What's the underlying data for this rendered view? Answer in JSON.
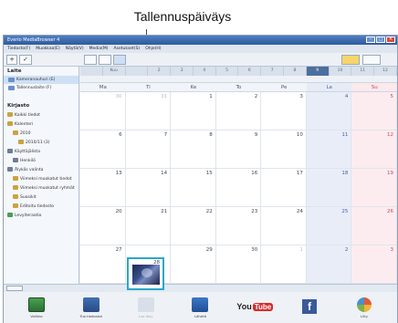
{
  "callout": {
    "label": "Tallennuspäiväys"
  },
  "window": {
    "title": "Everio MediaBrowser 4",
    "menu": [
      "Tiedosto(F)",
      "Muokkaa(E)",
      "Näytä(V)",
      "Media(M)",
      "Asetukset(S)",
      "Ohje(H)"
    ],
    "buttons": {
      "minimize": "–",
      "maximize": "□",
      "close": "×"
    }
  },
  "toolbar": {
    "add": "+",
    "tools": "✓",
    "display": "Grid",
    "zoom": "▢"
  },
  "library": {
    "header": "Laite",
    "items": [
      {
        "label": "Kameranauhuri (E)",
        "selected": true
      },
      {
        "label": "Tallennuslaite (F)",
        "selected": false
      }
    ]
  },
  "tree": {
    "header": "Kirjasto",
    "items": [
      {
        "label": "Kaikki tiedot",
        "indent": 0,
        "icon": "folder"
      },
      {
        "label": "Kalenteri",
        "indent": 0,
        "icon": "folder"
      },
      {
        "label": "2010",
        "indent": 1,
        "icon": "folder"
      },
      {
        "label": "2010/11 (3)",
        "indent": 2,
        "icon": "folder"
      },
      {
        "label": "Käyttäjälista",
        "indent": 0,
        "icon": "people"
      },
      {
        "label": "Henkilö",
        "indent": 1,
        "icon": "people"
      },
      {
        "label": "Älykäs valinta",
        "indent": 0,
        "icon": "people"
      },
      {
        "label": "Viimeksi muokatut tiedot",
        "indent": 1,
        "icon": "folder"
      },
      {
        "label": "Viimeksi muokatut ryhmät",
        "indent": 1,
        "icon": "folder"
      },
      {
        "label": "Suosikit",
        "indent": 1,
        "icon": "folder"
      },
      {
        "label": "Editoitu tiedosto",
        "indent": 1,
        "icon": "folder"
      },
      {
        "label": "Levyiteraatio",
        "indent": 0,
        "icon": "globe"
      }
    ]
  },
  "calendar": {
    "months": [
      "",
      "Kuu",
      "",
      "2",
      "3",
      "4",
      "5",
      "6",
      "7",
      "8",
      "9",
      "10",
      "11",
      "12"
    ],
    "current_month_index": 10,
    "weekdays": [
      "Ma",
      "Ti",
      "Ke",
      "To",
      "Pe",
      "La",
      "Su"
    ],
    "weeks": [
      [
        {
          "d": "30",
          "dim": true
        },
        {
          "d": "31",
          "dim": true
        },
        {
          "d": "1"
        },
        {
          "d": "2"
        },
        {
          "d": "3"
        },
        {
          "d": "4"
        },
        {
          "d": "5"
        }
      ],
      [
        {
          "d": "6"
        },
        {
          "d": "7"
        },
        {
          "d": "8"
        },
        {
          "d": "9"
        },
        {
          "d": "10"
        },
        {
          "d": "11"
        },
        {
          "d": "12"
        }
      ],
      [
        {
          "d": "13"
        },
        {
          "d": "14"
        },
        {
          "d": "15"
        },
        {
          "d": "16"
        },
        {
          "d": "17"
        },
        {
          "d": "18"
        },
        {
          "d": "19"
        }
      ],
      [
        {
          "d": "20"
        },
        {
          "d": "21"
        },
        {
          "d": "22"
        },
        {
          "d": "23"
        },
        {
          "d": "24"
        },
        {
          "d": "25"
        },
        {
          "d": "26"
        }
      ],
      [
        {
          "d": "27"
        },
        {
          "d": "28"
        },
        {
          "d": "29"
        },
        {
          "d": "30"
        },
        {
          "d": "1",
          "dim": true
        },
        {
          "d": "2",
          "dim": true
        },
        {
          "d": "3",
          "dim": true
        }
      ]
    ],
    "highlighted_day": "28"
  },
  "actions": [
    {
      "label": "Valikko",
      "kind": "g1",
      "enabled": true
    },
    {
      "label": "Tuo tiedostot",
      "kind": "g2",
      "enabled": true
    },
    {
      "label": "Luo levy",
      "kind": "g3",
      "enabled": false
    },
    {
      "label": "Lähetä",
      "kind": "g4",
      "enabled": true
    },
    {
      "label": "",
      "kind": "youtube",
      "enabled": true
    },
    {
      "label": "",
      "kind": "facebook",
      "enabled": true
    },
    {
      "label": "Liity",
      "kind": "g6",
      "enabled": true
    }
  ],
  "brand": {
    "youtube_text": "You",
    "youtube_tube": "Tube",
    "facebook_text": "f"
  }
}
